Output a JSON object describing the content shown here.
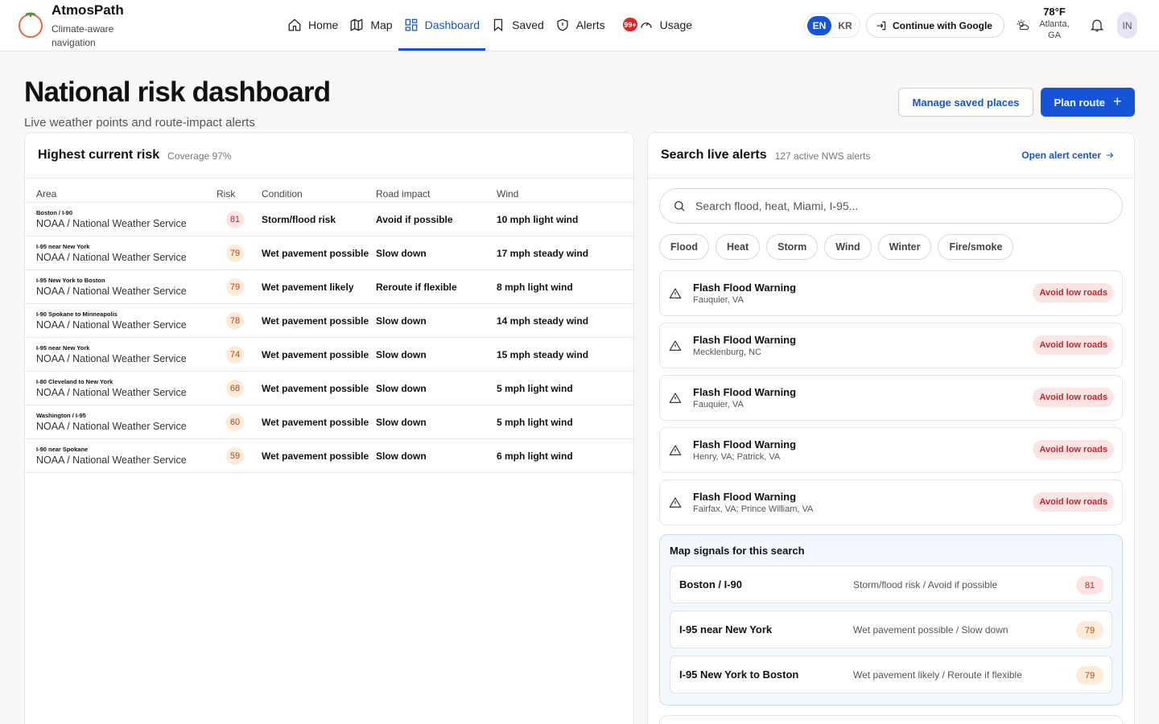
{
  "app": {
    "name": "AtmosPath",
    "tagline": "Climate-aware navigation"
  },
  "nav": [
    {
      "label": "Home",
      "icon": "home-icon"
    },
    {
      "label": "Map",
      "icon": "map-icon"
    },
    {
      "label": "Dashboard",
      "icon": "dashboard-icon",
      "active": true
    },
    {
      "label": "Saved",
      "icon": "bookmark-icon"
    },
    {
      "label": "Alerts",
      "icon": "shield-alert-icon"
    },
    {
      "label": "Usage",
      "icon": "gauge-icon"
    }
  ],
  "alerts_badge": "99+",
  "language": {
    "en": "EN",
    "kr": "KR",
    "selected": "EN"
  },
  "auth": {
    "google_label": "Continue with Google"
  },
  "weather": {
    "temp": "78°F",
    "location": "Atlanta, GA"
  },
  "user": {
    "initials": "IN"
  },
  "page": {
    "title": "National risk dashboard",
    "subtitle": "Live weather points and route-impact alerts",
    "manage_label": "Manage saved places",
    "plan_label": "Plan route",
    "plan_icon": "+"
  },
  "risk_table": {
    "title": "Highest current risk",
    "meta": "Coverage 97%",
    "headers": {
      "area": "Area",
      "risk": "Risk",
      "condition": "Condition",
      "road": "Road impact",
      "wind": "Wind"
    },
    "rows": [
      {
        "area": "Boston / I-90",
        "source": "NOAA / National Weather Service",
        "risk": "81",
        "condition": "Storm/flood risk",
        "road": "Avoid if possible",
        "wind": "10 mph light wind"
      },
      {
        "area": "I-95 near New York",
        "source": "NOAA / National Weather Service",
        "risk": "79",
        "condition": "Wet pavement possible",
        "road": "Slow down",
        "wind": "17 mph steady wind"
      },
      {
        "area": "I-95 New York to Boston",
        "source": "NOAA / National Weather Service",
        "risk": "79",
        "condition": "Wet pavement likely",
        "road": "Reroute if flexible",
        "wind": "8 mph light wind"
      },
      {
        "area": "I-90 Spokane to Minneapolis",
        "source": "NOAA / National Weather Service",
        "risk": "78",
        "condition": "Wet pavement possible",
        "road": "Slow down",
        "wind": "14 mph steady wind"
      },
      {
        "area": "I-95 near New York",
        "source": "NOAA / National Weather Service",
        "risk": "74",
        "condition": "Wet pavement possible",
        "road": "Slow down",
        "wind": "15 mph steady wind"
      },
      {
        "area": "I-80 Cleveland to New York",
        "source": "NOAA / National Weather Service",
        "risk": "68",
        "condition": "Wet pavement possible",
        "road": "Slow down",
        "wind": "5 mph light wind"
      },
      {
        "area": "Washington / I-95",
        "source": "NOAA / National Weather Service",
        "risk": "60",
        "condition": "Wet pavement possible",
        "road": "Slow down",
        "wind": "5 mph light wind"
      },
      {
        "area": "I-90 near Spokane",
        "source": "NOAA / National Weather Service",
        "risk": "59",
        "condition": "Wet pavement possible",
        "road": "Slow down",
        "wind": "6 mph light wind"
      }
    ]
  },
  "alerts_panel": {
    "title": "Search live alerts",
    "meta": "127 active NWS alerts",
    "open_label": "Open alert center",
    "search_placeholder": "Search flood, heat, Miami, I-95...",
    "chips": [
      "Flood",
      "Heat",
      "Storm",
      "Wind",
      "Winter",
      "Fire/smoke"
    ],
    "items": [
      {
        "title": "Flash Flood Warning",
        "location": "Fauquier, VA",
        "tag": "Avoid low roads"
      },
      {
        "title": "Flash Flood Warning",
        "location": "Mecklenburg, NC",
        "tag": "Avoid low roads"
      },
      {
        "title": "Flash Flood Warning",
        "location": "Fauquier, VA",
        "tag": "Avoid low roads"
      },
      {
        "title": "Flash Flood Warning",
        "location": "Henry, VA; Patrick, VA",
        "tag": "Avoid low roads"
      },
      {
        "title": "Flash Flood Warning",
        "location": "Fairfax, VA; Prince William, VA",
        "tag": "Avoid low roads"
      }
    ],
    "signals_title": "Map signals for this search",
    "signals": [
      {
        "area": "Boston / I-90",
        "desc": "Storm/flood risk / Avoid if possible",
        "risk": "81"
      },
      {
        "area": "I-95 near New York",
        "desc": "Wet pavement possible / Slow down",
        "risk": "79"
      },
      {
        "area": "I-95 New York to Boston",
        "desc": "Wet pavement likely / Reroute if flexible",
        "risk": "79"
      }
    ]
  },
  "colors": {
    "accent": "#1554d6",
    "risk_high_bg": "#fde4e4",
    "risk_high_fg": "#c0272d",
    "risk_mid_bg": "#fdebd9",
    "risk_mid_fg": "#c2410c"
  }
}
